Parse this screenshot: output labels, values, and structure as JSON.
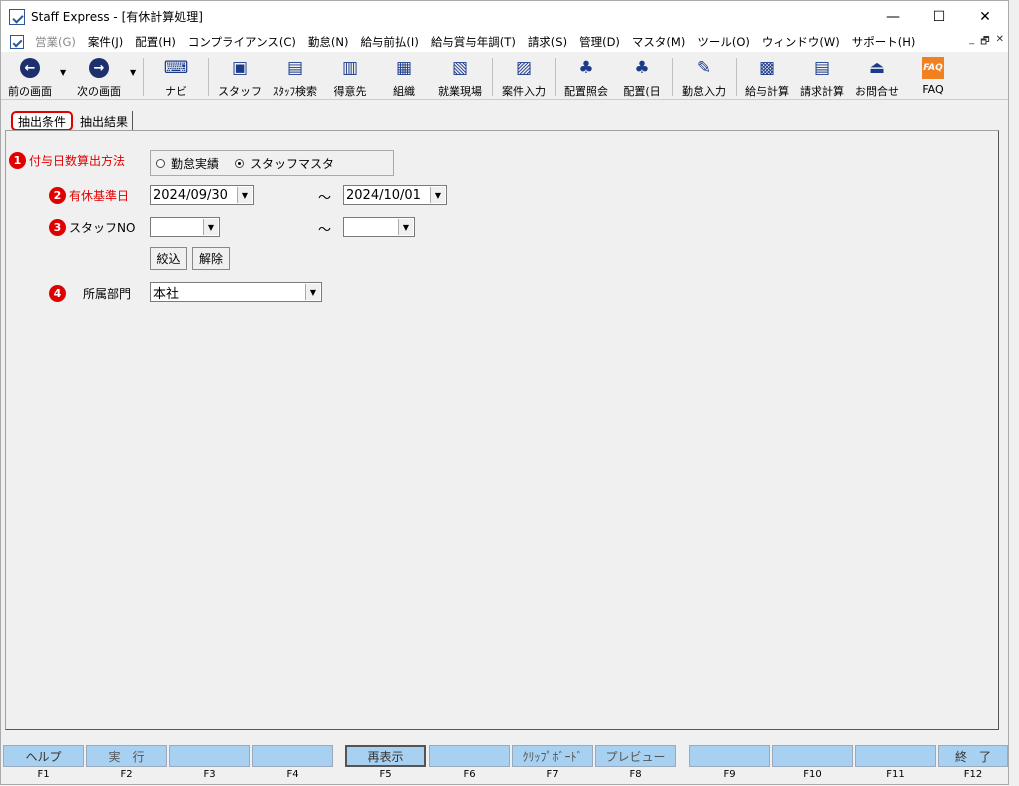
{
  "window": {
    "title": "Staff Express - [有休計算処理]",
    "minimize": "—",
    "maximize": "☐",
    "close": "✕"
  },
  "menubar": {
    "items": [
      {
        "label": "営業(G)",
        "disabled": true
      },
      {
        "label": "案件(J)"
      },
      {
        "label": "配置(H)"
      },
      {
        "label": "コンプライアンス(C)"
      },
      {
        "label": "勤怠(N)"
      },
      {
        "label": "給与前払(I)"
      },
      {
        "label": "給与賞与年調(T)"
      },
      {
        "label": "請求(S)"
      },
      {
        "label": "管理(D)"
      },
      {
        "label": "マスタ(M)"
      },
      {
        "label": "ツール(O)"
      },
      {
        "label": "ウィンドウ(W)"
      },
      {
        "label": "サポート(H)"
      }
    ],
    "mdi": {
      "min": "_",
      "restore": "🗗",
      "close": "✕"
    }
  },
  "toolbar": {
    "items": [
      {
        "label": "前の画面",
        "icon": "back-arrow-icon"
      },
      {
        "label": "次の画面",
        "icon": "forward-arrow-icon"
      },
      {
        "label": "ナビ",
        "icon": "keyboard-icon"
      },
      {
        "label": "スタッフ",
        "icon": "staff-icon"
      },
      {
        "label": "ｽﾀｯﾌ検索",
        "icon": "staff-search-icon"
      },
      {
        "label": "得意先",
        "icon": "client-icon"
      },
      {
        "label": "組織",
        "icon": "organization-icon"
      },
      {
        "label": "就業現場",
        "icon": "worksite-icon"
      },
      {
        "label": "案件入力",
        "icon": "case-entry-icon"
      },
      {
        "label": "配置照会",
        "icon": "placement-inquiry-icon"
      },
      {
        "label": "配置(日",
        "icon": "placement-daily-icon"
      },
      {
        "label": "勤怠入力",
        "icon": "attendance-entry-icon"
      },
      {
        "label": "給与計算",
        "icon": "payroll-icon"
      },
      {
        "label": "請求計算",
        "icon": "billing-icon"
      },
      {
        "label": "お問合せ",
        "icon": "inquiry-icon"
      },
      {
        "label": "FAQ",
        "icon": "faq-icon",
        "icon_text": "FAQ"
      }
    ]
  },
  "tabs": {
    "conditions": "抽出条件",
    "results": "抽出結果"
  },
  "form": {
    "method": {
      "num": "1",
      "label": "付与日数算出方法",
      "options": [
        "勤怠実績",
        "スタッフマスタ"
      ],
      "selected": 1
    },
    "base_date": {
      "num": "2",
      "label": "有休基準日",
      "from": "2024/09/30",
      "to": "2024/10/01"
    },
    "staff_no": {
      "num": "3",
      "label": "スタッフNO",
      "from": "",
      "to": ""
    },
    "tilde": "～",
    "filter_btn": "絞込",
    "clear_btn": "解除",
    "dept": {
      "num": "4",
      "label": "所属部門",
      "value": "本社"
    }
  },
  "fkeys": [
    {
      "label": "ヘルプ",
      "key": "F1"
    },
    {
      "label": "実　行",
      "key": "F2"
    },
    {
      "label": "",
      "key": "F3"
    },
    {
      "label": "",
      "key": "F4"
    },
    {
      "label": "再表示",
      "key": "F5"
    },
    {
      "label": "",
      "key": "F6"
    },
    {
      "label": "ｸﾘｯﾌﾟﾎﾞｰﾄﾞ",
      "key": "F7"
    },
    {
      "label": "プレビュー",
      "key": "F8"
    },
    {
      "label": "",
      "key": "F9"
    },
    {
      "label": "",
      "key": "F10"
    },
    {
      "label": "",
      "key": "F11"
    },
    {
      "label": "終　了",
      "key": "F12"
    }
  ]
}
